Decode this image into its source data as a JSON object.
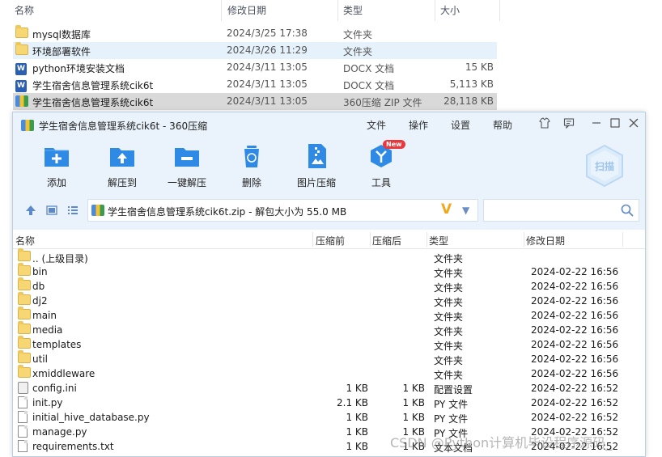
{
  "explorer": {
    "columns": [
      "名称",
      "修改日期",
      "类型",
      "大小"
    ],
    "rows": [
      {
        "name": "mysql数据库",
        "date": "2024/3/25 17:38",
        "type": "文件夹",
        "size": "",
        "icon": "folder-icon"
      },
      {
        "name": "环境部署软件",
        "date": "2024/3/26 11:29",
        "type": "文件夹",
        "size": "",
        "icon": "folder-icon"
      },
      {
        "name": "python环境安装文档",
        "date": "2024/3/11 13:05",
        "type": "DOCX 文档",
        "size": "15 KB",
        "icon": "docx-icon"
      },
      {
        "name": "学生宿舍信息管理系统cik6t",
        "date": "2024/3/11 13:05",
        "type": "DOCX 文档",
        "size": "5,113 KB",
        "icon": "docx-icon"
      },
      {
        "name": "学生宿舍信息管理系统cik6t",
        "date": "2024/3/11 13:05",
        "type": "360压缩 ZIP 文件",
        "size": "28,118 KB",
        "icon": "zip-icon"
      }
    ]
  },
  "zipwin": {
    "title": "学生宿舍信息管理系统cik6t - 360压缩",
    "menu": [
      "文件",
      "操作",
      "设置",
      "帮助"
    ],
    "toolbar": [
      {
        "label": "添加",
        "icon": "add-icon"
      },
      {
        "label": "解压到",
        "icon": "extract-to-icon"
      },
      {
        "label": "一键解压",
        "icon": "one-click-extract-icon"
      },
      {
        "label": "删除",
        "icon": "delete-icon"
      },
      {
        "label": "图片压缩",
        "icon": "image-compress-icon"
      },
      {
        "label": "工具",
        "icon": "tools-icon",
        "badge": "New"
      }
    ],
    "scan_label": "扫描",
    "address": "学生宿舍信息管理系统cik6t.zip - 解包大小为 55.0 MB",
    "columns": [
      "名称",
      "压缩前",
      "压缩后",
      "类型",
      "修改日期"
    ],
    "files": [
      {
        "name": ".. (上级目录)",
        "before": "",
        "after": "",
        "type": "文件夹",
        "date": "",
        "icon": "folder-icon"
      },
      {
        "name": "bin",
        "before": "",
        "after": "",
        "type": "文件夹",
        "date": "2024-02-22 16:56",
        "icon": "folder-icon"
      },
      {
        "name": "db",
        "before": "",
        "after": "",
        "type": "文件夹",
        "date": "2024-02-22 16:56",
        "icon": "folder-icon"
      },
      {
        "name": "dj2",
        "before": "",
        "after": "",
        "type": "文件夹",
        "date": "2024-02-22 16:56",
        "icon": "folder-icon"
      },
      {
        "name": "main",
        "before": "",
        "after": "",
        "type": "文件夹",
        "date": "2024-02-22 16:56",
        "icon": "folder-icon"
      },
      {
        "name": "media",
        "before": "",
        "after": "",
        "type": "文件夹",
        "date": "2024-02-22 16:56",
        "icon": "folder-icon"
      },
      {
        "name": "templates",
        "before": "",
        "after": "",
        "type": "文件夹",
        "date": "2024-02-22 16:56",
        "icon": "folder-icon"
      },
      {
        "name": "util",
        "before": "",
        "after": "",
        "type": "文件夹",
        "date": "2024-02-22 16:56",
        "icon": "folder-icon"
      },
      {
        "name": "xmiddleware",
        "before": "",
        "after": "",
        "type": "文件夹",
        "date": "2024-02-22 16:56",
        "icon": "folder-icon"
      },
      {
        "name": "config.ini",
        "before": "1 KB",
        "after": "1 KB",
        "type": "配置设置",
        "date": "2024-02-22 16:52",
        "icon": "config-file-icon"
      },
      {
        "name": "init.py",
        "before": "2.1 KB",
        "after": "1 KB",
        "type": "PY 文件",
        "date": "2024-02-22 16:52",
        "icon": "file-icon"
      },
      {
        "name": "initial_hive_database.py",
        "before": "1 KB",
        "after": "1 KB",
        "type": "PY 文件",
        "date": "2024-02-22 16:52",
        "icon": "file-icon"
      },
      {
        "name": "manage.py",
        "before": "1 KB",
        "after": "1 KB",
        "type": "PY 文件",
        "date": "2024-02-22 16:52",
        "icon": "file-icon"
      },
      {
        "name": "requirements.txt",
        "before": "1 KB",
        "after": "1 KB",
        "type": "文本文档",
        "date": "2024-02-22 16:52",
        "icon": "file-icon"
      }
    ]
  },
  "watermark": "CSDN @Python计算机毕设程序源码_"
}
